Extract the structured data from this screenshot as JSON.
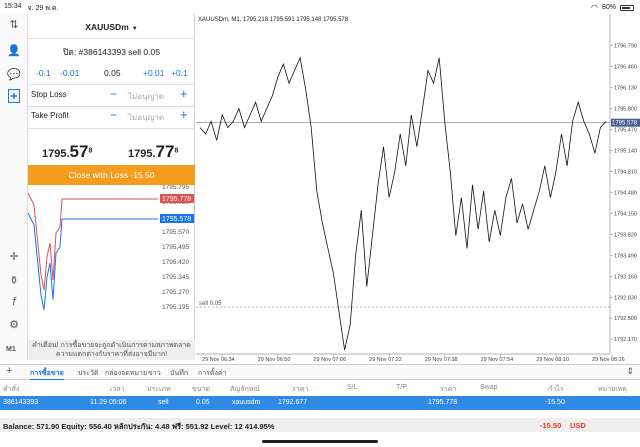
{
  "status": {
    "time": "15:34",
    "date": "จ. 29 พ.ค.",
    "battery": "80%"
  },
  "panel": {
    "symbol": "XAUUSDm",
    "ticket_text": "ปิด: #386143393 sell 0.05",
    "steps": [
      "-0.1",
      "-0.01",
      "0.05",
      "+0.01",
      "+0.1"
    ],
    "stop_loss_label": "Stop Loss",
    "take_profit_label": "Take Profit",
    "not_set": "ไม่อนุญาต",
    "bid": {
      "main": "1795.",
      "big": "57",
      "small": "8"
    },
    "ask": {
      "main": "1795.",
      "big": "77",
      "small": "8"
    },
    "close_label": "Close with Loss -15.50",
    "warning": "คำเตือน! การซื้อขายจะถูกดำเนินการตามสภาพตลาด ความแตกต่างกับราคาที่ส่งอาจมีมาก!",
    "mini_ticks": [
      "1795.795",
      "1795.720",
      "1795.645",
      "1795.570",
      "1795.495",
      "1795.420",
      "1795.345",
      "1795.270",
      "1795.195"
    ],
    "mini_ask_tag": "1795.778",
    "mini_bid_tag": "1795.578"
  },
  "chart": {
    "header": "XAUUSDm, M1, 1795.218 1795.591 1795.148 1795.578",
    "order_line_label": "sell 0.05",
    "price_tag": "1795.578",
    "y_ticks": [
      "1796.790",
      "1796.460",
      "1796.130",
      "1795.800",
      "1795.470",
      "1795.140",
      "1794.810",
      "1794.480",
      "1794.150",
      "1793.820",
      "1793.490",
      "1793.160",
      "1792.830",
      "1792.500",
      "1792.170"
    ],
    "x_ticks": [
      "29 Nov 06:34",
      "29 Nov 06:50",
      "29 Nov 07:06",
      "29 Nov 07:22",
      "29 Nov 07:38",
      "29 Nov 07:54",
      "29 Nov 08:10",
      "29 Nov 08:26"
    ]
  },
  "chart_data": {
    "type": "line",
    "title": "XAUUSDm, M1, 1795.218 1795.591 1795.148 1795.578",
    "xlabel": "",
    "ylabel": "",
    "ylim": [
      1792.0,
      1797.1
    ],
    "y_series": [
      1795.5,
      1795.4,
      1795.6,
      1795.3,
      1795.7,
      1795.5,
      1795.6,
      1795.8,
      1795.5,
      1795.7,
      1795.9,
      1795.6,
      1795.8,
      1796.0,
      1796.3,
      1796.5,
      1796.2,
      1796.4,
      1796.6,
      1796.1,
      1795.5,
      1794.5,
      1794.0,
      1793.6,
      1793.2,
      1792.6,
      1792.0,
      1792.4,
      1793.5,
      1794.2,
      1793.0,
      1793.8,
      1794.6,
      1795.2,
      1794.4,
      1794.8,
      1795.4,
      1794.9,
      1795.7,
      1795.2,
      1795.8,
      1796.4,
      1796.2,
      1796.6,
      1795.6,
      1794.8,
      1793.8,
      1794.4,
      1793.6,
      1794.6,
      1793.9,
      1794.5,
      1793.7,
      1794.2,
      1793.8,
      1794.4,
      1794.7,
      1794.0,
      1794.3,
      1793.9,
      1794.2,
      1794.5,
      1794.9,
      1794.4,
      1794.8,
      1795.4,
      1794.9,
      1795.6,
      1795.9,
      1795.6,
      1795.4,
      1795.1,
      1795.5,
      1795.6
    ],
    "reference_line": {
      "label": "sell 0.05",
      "value": 1792.677
    }
  },
  "tabs": [
    "การซื้อขาย",
    "ประวัติ",
    "กล่องจดหมาย",
    "ข่าว",
    "บันทึก",
    "การตั้งค่า"
  ],
  "table": {
    "headers": [
      "คำสั่ง",
      "เวลา",
      "ประเภท",
      "ขนาด",
      "สัญลักษณ์",
      "ราคา",
      "S/L",
      "T/P",
      "ราคา",
      "Swap",
      "กำไร",
      "หมายเหตุ"
    ],
    "row": [
      "386143393",
      "11.29 05:06",
      "sell",
      "0.05",
      "xauusdm",
      "1792.677",
      "",
      "",
      "1795.778",
      "",
      "-15.50",
      ""
    ]
  },
  "balance": {
    "text": "Balance: 571.90 Equity: 556.40 หลักประกัน: 4.48 ฟรี: 551.92 Level: 12 414.95%",
    "pl": "-15.50",
    "currency": "USD"
  },
  "colors": {
    "accent": "#1a73e8",
    "close_button": "#f39c1d",
    "ask_line": "#d9534f",
    "bid_line": "#1a73e8"
  }
}
